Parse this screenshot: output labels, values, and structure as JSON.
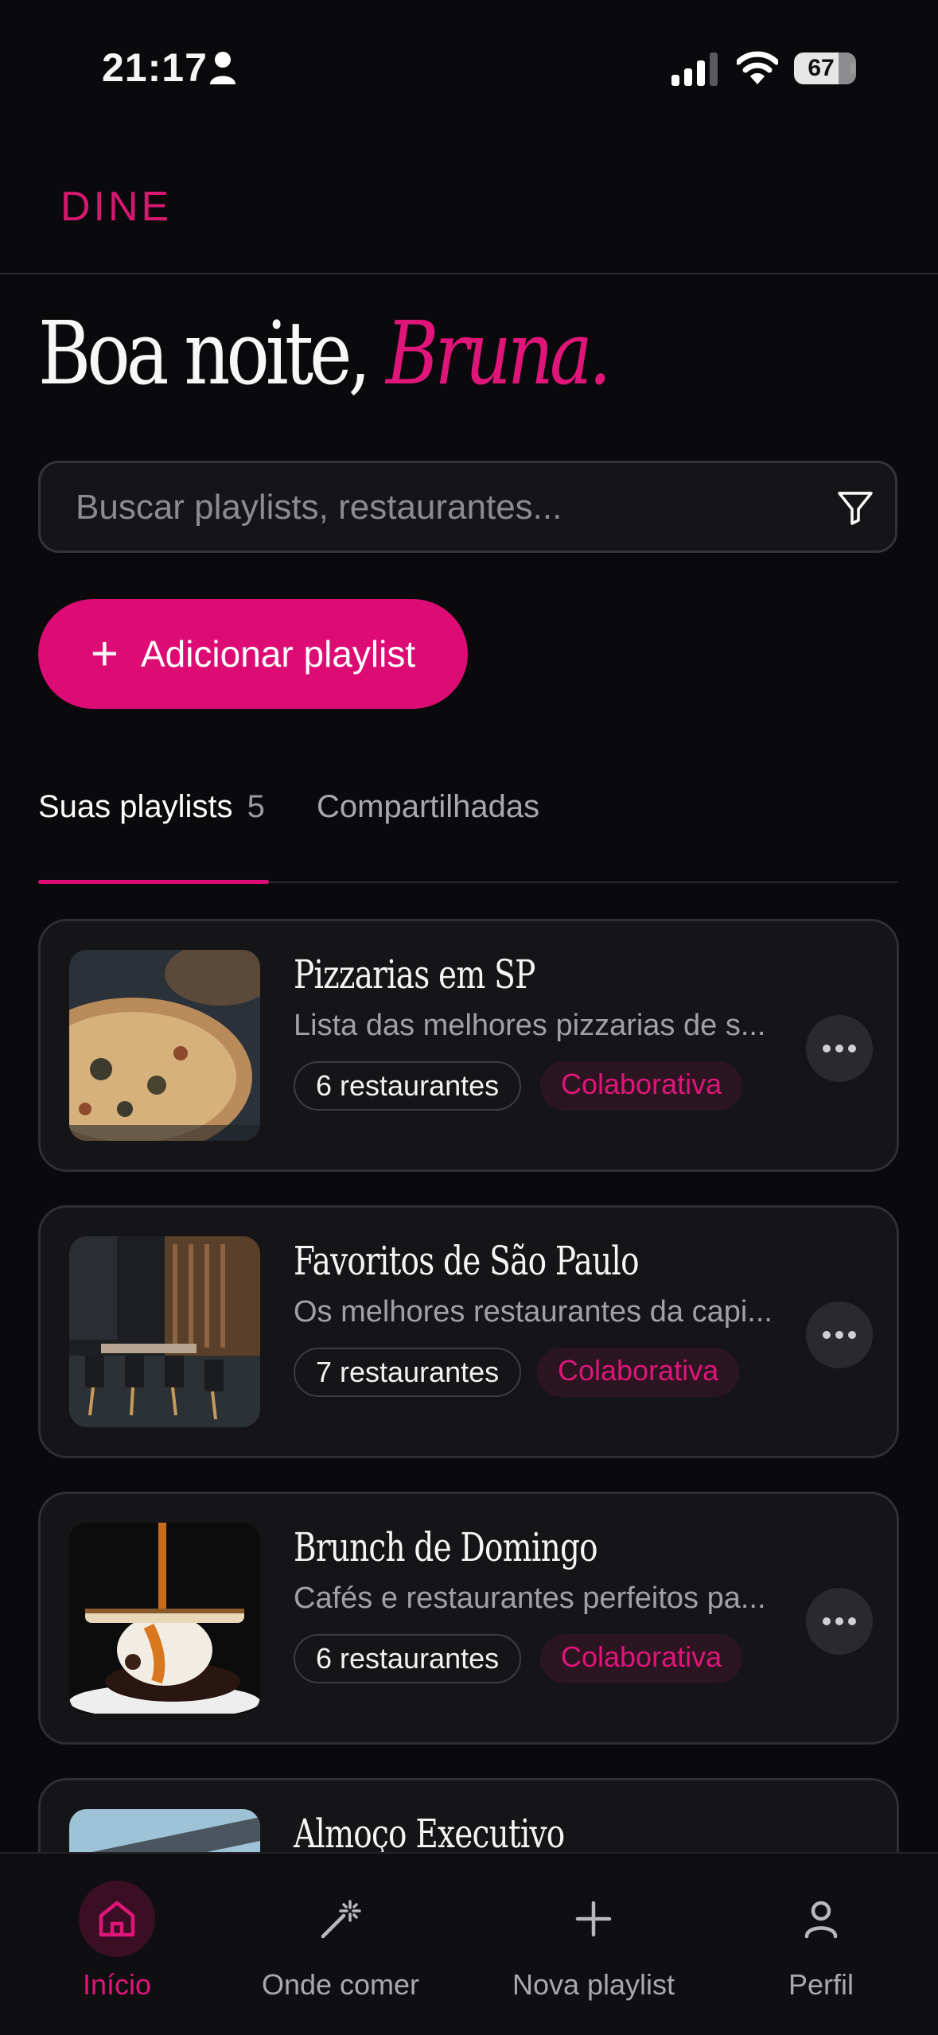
{
  "status_bar": {
    "time": "21:17",
    "battery": "67",
    "battery_level": 0.67
  },
  "header": {
    "brand": "DINE"
  },
  "greeting": {
    "prefix": "Boa noite, ",
    "name": "Bruna."
  },
  "search": {
    "placeholder": "Buscar playlists, restaurantes..."
  },
  "add_button": {
    "label": "Adicionar playlist"
  },
  "tabs": {
    "yours_label": "Suas playlists",
    "yours_count": "5",
    "shared_label": "Compartilhadas"
  },
  "playlists": [
    {
      "title": "Pizzarias em SP",
      "description": "Lista das melhores pizzarias de s...",
      "count": "6 restaurantes",
      "tag": "Colaborativa",
      "image": "pizza-photo"
    },
    {
      "title": "Favoritos de São Paulo",
      "description": "Os melhores restaurantes da capi...",
      "count": "7 restaurantes",
      "tag": "Colaborativa",
      "image": "restaurant-interior-photo"
    },
    {
      "title": "Brunch de Domingo",
      "description": "Cafés e restaurantes perfeitos pa...",
      "count": "6 restaurantes",
      "tag": "Colaborativa",
      "image": "dessert-photo"
    },
    {
      "title": "Almoço Executivo",
      "image": "terrace-photo"
    }
  ],
  "tabbar": {
    "items": [
      {
        "label": "Início",
        "icon": "home-icon",
        "active": true
      },
      {
        "label": "Onde comer",
        "icon": "magic-wand-icon"
      },
      {
        "label": "Nova playlist",
        "icon": "plus-icon"
      },
      {
        "label": "Perfil",
        "icon": "person-icon"
      }
    ]
  },
  "colors": {
    "accent": "#dc0c74",
    "background": "#0a0a0c",
    "card": "#151518"
  }
}
